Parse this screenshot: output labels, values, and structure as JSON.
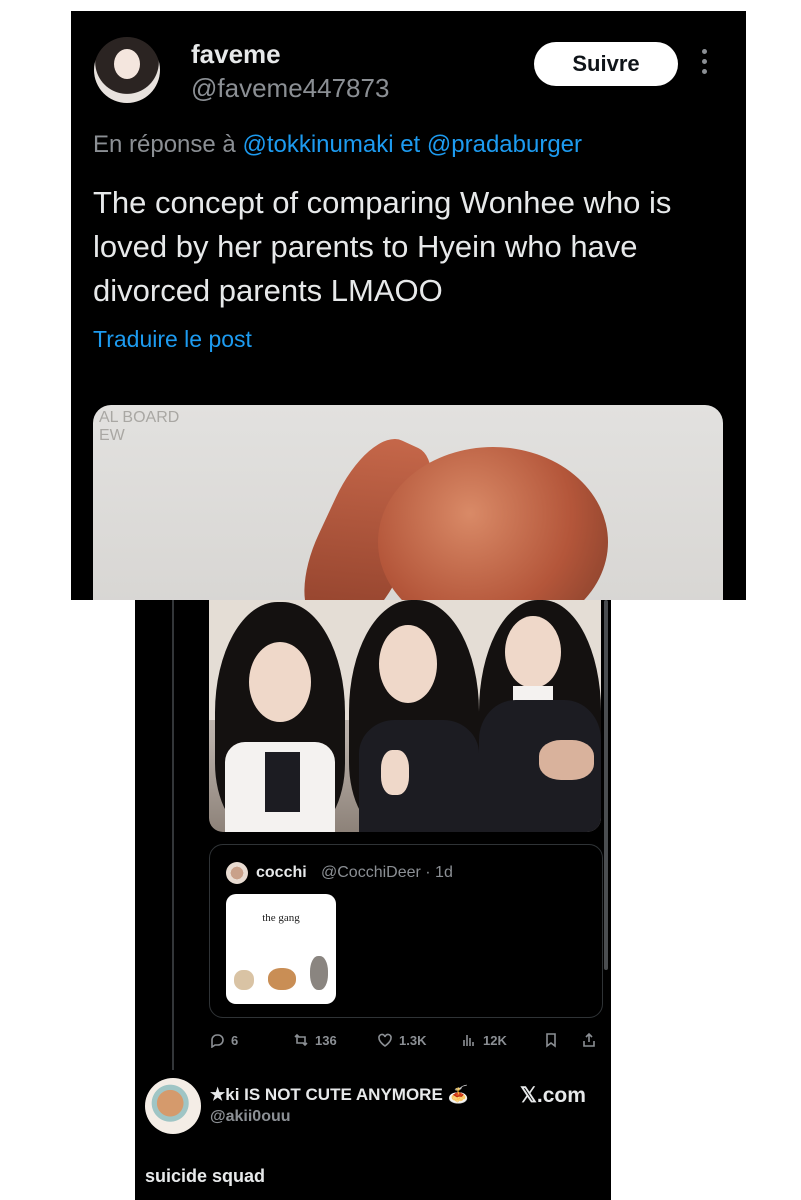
{
  "post": {
    "display_name": "faveme",
    "handle": "@faveme447873",
    "follow_label": "Suivre",
    "reply_prefix": "En réponse à",
    "reply_to_1": "@tokkinumaki",
    "reply_joiner": "et",
    "reply_to_2": "@pradaburger",
    "text": "The concept of comparing Wonhee who is loved by her parents to Hyein who have divorced parents LMAOO",
    "translate_label": "Traduire le post",
    "media_wall_text": "AL BOARD\nEW"
  },
  "quoted": {
    "name": "cocchi",
    "meta": "@CocchiDeer · 1d",
    "image_caption": "the gang"
  },
  "actions": {
    "replies": "6",
    "reposts": "136",
    "likes": "1.3K",
    "views": "12K"
  },
  "reply": {
    "display_name": "★ki IS NOT CUTE ANYMORE 🍝",
    "handle": "@akii0ouu",
    "watermark": "𝕏.com",
    "text": "suicide squad"
  },
  "colors": {
    "background": "#000000",
    "link": "#1d9bf0",
    "text": "#e7e9ea",
    "muted": "#8b8f94"
  }
}
